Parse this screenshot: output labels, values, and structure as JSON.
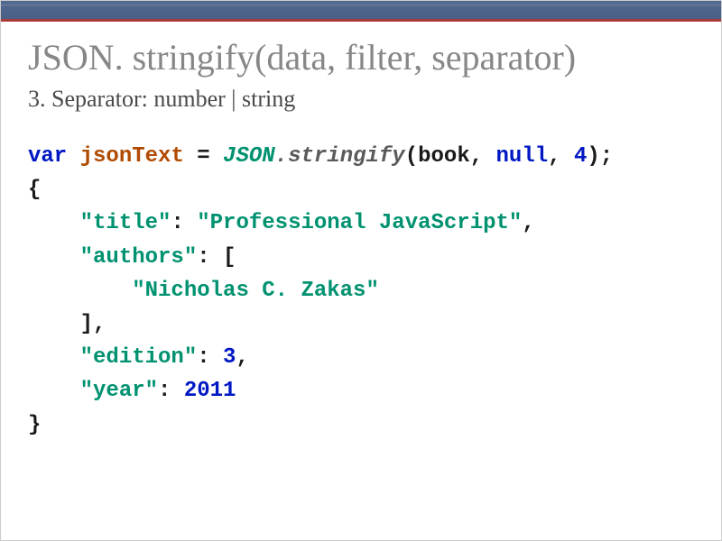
{
  "title": "JSON. stringify(data, filter, separator)",
  "subtitle": "3. Separator: number | string",
  "code": {
    "kw_var": "var",
    "ident": "jsonText",
    "eq": " = ",
    "cls": "JSON",
    "dot": ".",
    "method": "stringify",
    "lparen": "(",
    "arg1": "book",
    "comma1": ", ",
    "arg2": "null",
    "comma2": ", ",
    "arg3": "4",
    "rparen": ")",
    "semi": ";",
    "lbrace": "{",
    "k_title": "\"title\"",
    "v_title": "\"Professional JavaScript\"",
    "k_authors": "\"authors\"",
    "lbracket": "[",
    "author0": "\"Nicholas C. Zakas\"",
    "rbracket": "]",
    "k_edition": "\"edition\"",
    "v_edition": "3",
    "k_year": "\"year\"",
    "v_year": "2011",
    "rbrace": "}",
    "colon": ":",
    "comma": ","
  }
}
